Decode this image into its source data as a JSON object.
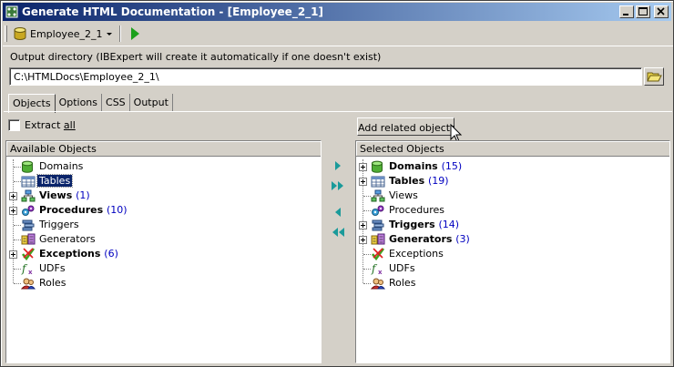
{
  "window": {
    "title": "Generate HTML Documentation - [Employee_2_1]"
  },
  "toolbar": {
    "database_label": "Employee_2_1"
  },
  "output": {
    "label": "Output directory (IBExpert will create it automatically if one doesn't exist)",
    "value": "C:\\HTMLDocs\\Employee_2_1\\"
  },
  "tabs": [
    {
      "label": "Objects",
      "active": true
    },
    {
      "label": "Options",
      "active": false
    },
    {
      "label": "CSS",
      "active": false
    },
    {
      "label": "Output",
      "active": false
    }
  ],
  "extract_all": {
    "prefix": "Extract ",
    "underlined": "all",
    "checked": false
  },
  "add_related_label": "Add related objects",
  "available": {
    "header": "Available Objects",
    "items": [
      {
        "label": "Domains",
        "count": "",
        "bold": false,
        "expandable": false,
        "icon": "domains-icon"
      },
      {
        "label": "Tables",
        "count": "",
        "bold": false,
        "expandable": false,
        "icon": "tables-icon",
        "selected": true
      },
      {
        "label": "Views",
        "count": "(1)",
        "bold": true,
        "expandable": true,
        "icon": "views-icon"
      },
      {
        "label": "Procedures",
        "count": "(10)",
        "bold": true,
        "expandable": true,
        "icon": "procedures-icon"
      },
      {
        "label": "Triggers",
        "count": "",
        "bold": false,
        "expandable": false,
        "icon": "triggers-icon"
      },
      {
        "label": "Generators",
        "count": "",
        "bold": false,
        "expandable": false,
        "icon": "generators-icon"
      },
      {
        "label": "Exceptions",
        "count": "(6)",
        "bold": true,
        "expandable": true,
        "icon": "exceptions-icon"
      },
      {
        "label": "UDFs",
        "count": "",
        "bold": false,
        "expandable": false,
        "icon": "udfs-icon"
      },
      {
        "label": "Roles",
        "count": "",
        "bold": false,
        "expandable": false,
        "icon": "roles-icon"
      }
    ]
  },
  "selected": {
    "header": "Selected Objects",
    "items": [
      {
        "label": "Domains",
        "count": "(15)",
        "bold": true,
        "expandable": true,
        "icon": "domains-icon"
      },
      {
        "label": "Tables",
        "count": "(19)",
        "bold": true,
        "expandable": true,
        "icon": "tables-icon"
      },
      {
        "label": "Views",
        "count": "",
        "bold": false,
        "expandable": false,
        "icon": "views-icon"
      },
      {
        "label": "Procedures",
        "count": "",
        "bold": false,
        "expandable": false,
        "icon": "procedures-icon"
      },
      {
        "label": "Triggers",
        "count": "(14)",
        "bold": true,
        "expandable": true,
        "icon": "triggers-icon"
      },
      {
        "label": "Generators",
        "count": "(3)",
        "bold": true,
        "expandable": true,
        "icon": "generators-icon"
      },
      {
        "label": "Exceptions",
        "count": "",
        "bold": false,
        "expandable": false,
        "icon": "exceptions-icon"
      },
      {
        "label": "UDFs",
        "count": "",
        "bold": false,
        "expandable": false,
        "icon": "udfs-icon"
      },
      {
        "label": "Roles",
        "count": "",
        "bold": false,
        "expandable": false,
        "icon": "roles-icon"
      }
    ]
  },
  "colors": {
    "title_bar_start": "#0a246a",
    "title_bar_end": "#a6caf0",
    "selection": "#0a246a",
    "count_text": "#0000c0",
    "arrow_green": "#1a9a9a"
  }
}
